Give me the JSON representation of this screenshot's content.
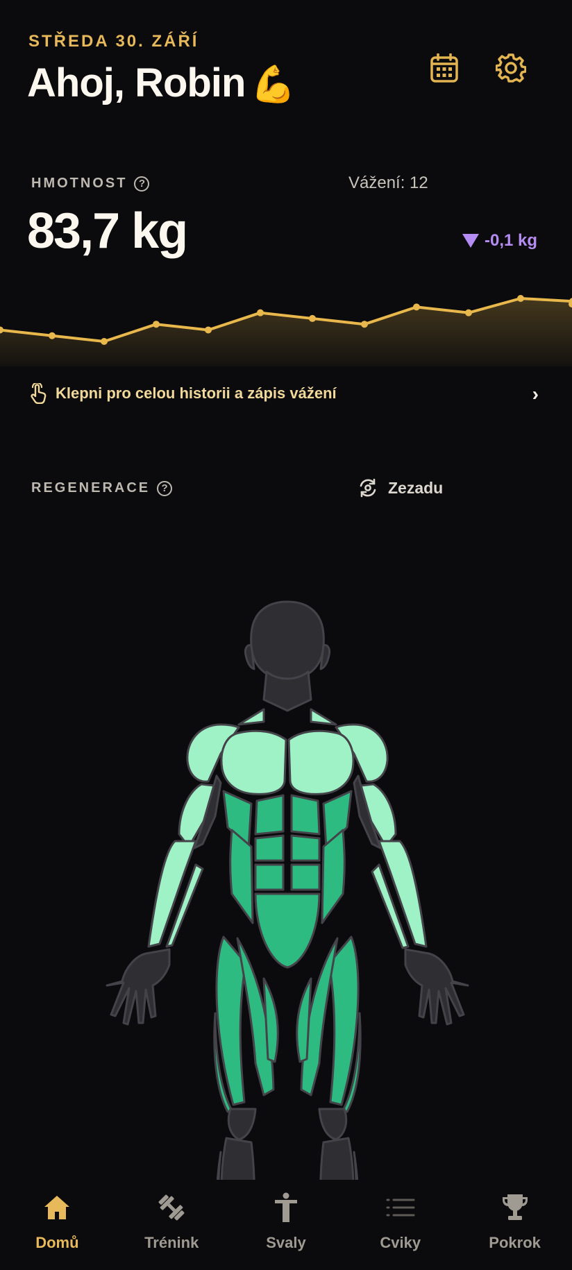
{
  "header": {
    "date": "STŘEDA 30. ZÁŘÍ",
    "greeting": "Ahoj, Robin",
    "emoji": "💪",
    "icons": [
      "calendar-icon",
      "gear-icon"
    ]
  },
  "weight": {
    "label": "HMOTNOST",
    "help": "?",
    "count_text": "Vážení: 12",
    "value": "83,7 kg",
    "delta": "-0,1 kg",
    "delta_direction": "down",
    "trend_values": [
      83.9,
      83.8,
      83.7,
      84.0,
      83.9,
      84.2,
      84.1,
      84.0,
      84.3,
      84.2,
      84.45,
      84.4
    ],
    "colors": {
      "line": "#e9b84c",
      "delta": "#b58cf2"
    }
  },
  "history_link": {
    "text": "Klepni pro celou historii a zápis vážení",
    "icon": "tap-hand-icon"
  },
  "recovery": {
    "label": "REGENERACE",
    "help": "?",
    "toggle_label": "Zezadu",
    "toggle_icon": "rotate-camera-icon",
    "colors": {
      "fresh": "#9ff1c6",
      "mid": "#2dbb82",
      "none": "#2f2e33"
    }
  },
  "nav": {
    "items": [
      {
        "label": "Domů",
        "icon": "home-icon",
        "active": true
      },
      {
        "label": "Trénink",
        "icon": "dumbbell-icon",
        "active": false
      },
      {
        "label": "Svaly",
        "icon": "person-icon",
        "active": false
      },
      {
        "label": "Cviky",
        "icon": "list-icon",
        "active": false
      },
      {
        "label": "Pokrok",
        "icon": "trophy-icon",
        "active": false
      }
    ]
  }
}
